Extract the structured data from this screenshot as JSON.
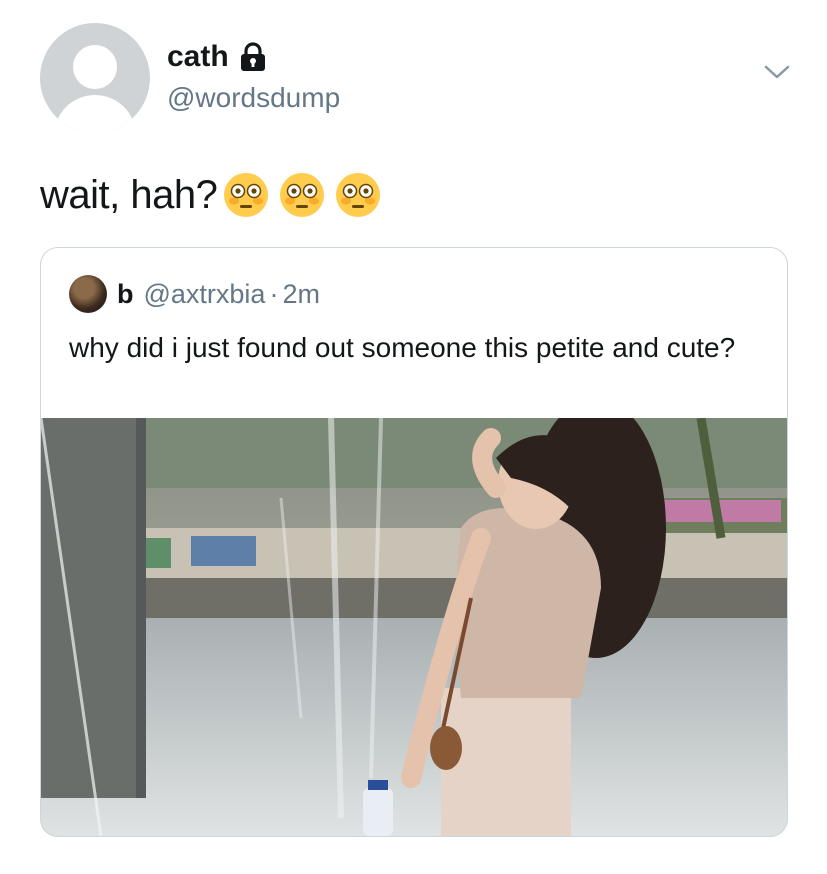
{
  "user": {
    "display_name": "cath",
    "handle": "@wordsdump"
  },
  "tweet": {
    "text": "wait, hah?",
    "emojis": [
      "flushed-face-icon",
      "flushed-face-icon",
      "flushed-face-icon"
    ]
  },
  "quoted_tweet": {
    "display_name": "b",
    "handle": "@axtrxbia",
    "separator": "·",
    "time": "2m",
    "text": "why did i just found out someone this petite and cute?"
  },
  "colors": {
    "text_primary": "#14171a",
    "text_secondary": "#657786",
    "border": "#ccd6dd",
    "avatar_placeholder": "#cfd3d6"
  }
}
